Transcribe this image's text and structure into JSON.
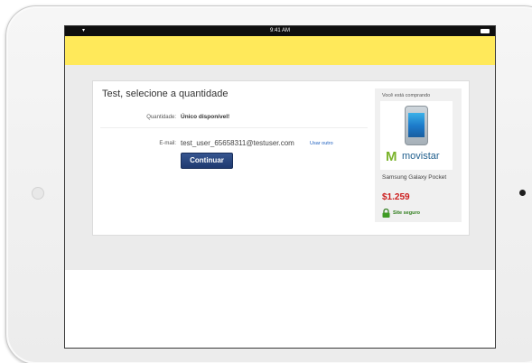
{
  "status_bar": {
    "time": "9:41 AM"
  },
  "page": {
    "title": "Test, selecione a quantidade",
    "quantity": {
      "label": "Quantidade:",
      "value": "Único disponível!"
    },
    "email": {
      "label": "E-mail:",
      "value": "test_user_65658311@testuser.com",
      "use_other_label": "Usar outro"
    },
    "continue_label": "Continuar"
  },
  "product": {
    "heading": "Você está comprando",
    "brand": "movistar",
    "name": "Samsung Galaxy Pocket",
    "price": "$1.259",
    "secure_label": "Site seguro"
  },
  "colors": {
    "header_yellow": "#ffe95a",
    "button_blue": "#1f3a70",
    "price_red": "#cc1d1d",
    "secure_green": "#2f7d1c",
    "movistar_green": "#7ab32a",
    "movistar_blue": "#1f5e8d"
  }
}
